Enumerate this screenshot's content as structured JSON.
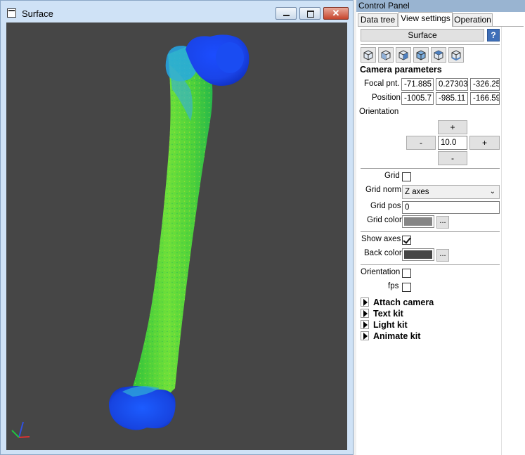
{
  "surface_window": {
    "title": "Surface",
    "close_glyph": "✕",
    "icon": "window-icon",
    "viewport_background": "#464646",
    "axes_colors": {
      "x": "#e03030",
      "y": "#20c040",
      "z": "#3050e0"
    }
  },
  "control_panel": {
    "title": "Control Panel",
    "tabs": [
      "Data tree",
      "View settings",
      "Operation"
    ],
    "active_tab": "View settings",
    "object_button": "Surface",
    "help_label": "?",
    "camera_view_icons": [
      "view-front-icon",
      "view-back-icon",
      "view-left-icon",
      "view-right-icon",
      "view-top-icon",
      "view-bottom-icon"
    ],
    "camera_section_title": "Camera parameters",
    "focal_label": "Focal pnt.",
    "focal_values": [
      "-71.885",
      "0.27303",
      "-326.25"
    ],
    "position_label": "Position",
    "position_values": [
      "-1005.7",
      "-985.11",
      "-166.59"
    ],
    "orientation_label": "Orientation",
    "rotation": {
      "up": "+",
      "left": "-",
      "step": "10.0",
      "right": "+",
      "down": "-"
    },
    "grid": {
      "label": "Grid",
      "checked": false
    },
    "grid_norm": {
      "label": "Grid norm",
      "value": "Z axes"
    },
    "grid_pos": {
      "label": "Grid pos",
      "value": "0"
    },
    "grid_color": {
      "label": "Grid color",
      "color": "#858585",
      "button": "..."
    },
    "show_axes": {
      "label": "Show axes",
      "checked": true
    },
    "back_color": {
      "label": "Back color",
      "color": "#464646",
      "button": "..."
    },
    "orientation_check": {
      "label": "Orientation",
      "checked": false
    },
    "fps": {
      "label": "fps",
      "checked": false
    },
    "kits": [
      "Attach camera",
      "Text kit",
      "Light kit",
      "Animate kit"
    ]
  }
}
